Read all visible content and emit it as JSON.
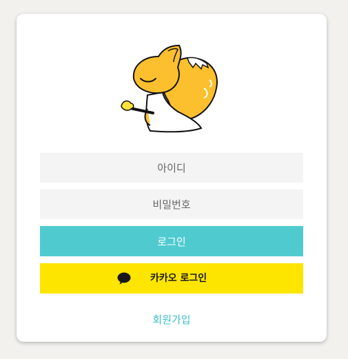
{
  "login_form": {
    "mascot_icon": "sleeping-squirrel-mascot-icon",
    "id_placeholder": "아이디",
    "password_placeholder": "비밀번호",
    "login_label": "로그인",
    "kakao_icon": "kakao-speech-bubble-icon",
    "kakao_login_label": "카카오 로그인",
    "signup_label": "회원가입"
  },
  "colors": {
    "page_background": "#f2f1ee",
    "card_background": "#ffffff",
    "input_background": "#f4f4f4",
    "login_button": "#4fcbd0",
    "kakao_button": "#fee500",
    "signup_link": "#3cbfc6",
    "mascot_yellow": "#fcbf2d"
  }
}
